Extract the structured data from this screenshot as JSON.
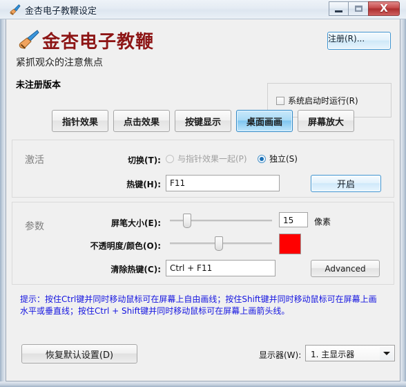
{
  "window": {
    "title": "金杏电子教鞭设定",
    "title_icon": "brush-pen-icon",
    "minimize_label": "",
    "maximize_label": "",
    "close_label": "X"
  },
  "header": {
    "logo_icon": "brush-pen-icon",
    "app_name": "金杏电子教鞭",
    "tagline": "紧抓观众的注意焦点",
    "license_status": "未注册版本",
    "register_button": "注册(R)...",
    "startup_checkbox_label": "系统启动时运行(R)",
    "startup_checked": false,
    "brand_color": "#8d1616"
  },
  "tabs": [
    {
      "label": "指针效果",
      "active": false
    },
    {
      "label": "点击效果",
      "active": false
    },
    {
      "label": "按键显示",
      "active": false
    },
    {
      "label": "桌面画画",
      "active": true
    },
    {
      "label": "屏幕放大",
      "active": false
    }
  ],
  "activate": {
    "section_title": "激活",
    "switch_label": "切换(T):",
    "radio_together": "与指针效果一起(P)",
    "radio_together_selected": false,
    "radio_together_disabled": true,
    "radio_standalone": "独立(S)",
    "radio_standalone_selected": true,
    "hotkey_label": "热键(H):",
    "hotkey_value": "F11",
    "start_button": "开启"
  },
  "params": {
    "section_title": "参数",
    "pen_size_label": "屏笔大小(E):",
    "pen_size_value": "15",
    "pen_size_unit": "像素",
    "pen_size_percent": 17,
    "opacity_label": "不透明度/颜色(O):",
    "opacity_percent": 48,
    "color_value": "#ff0000",
    "clear_hotkey_label": "清除热键(C):",
    "clear_hotkey_value": "Ctrl + F11",
    "advanced_button": "Advanced"
  },
  "hint": {
    "text": "提示：按住Ctrl键并同时移动鼠标可在屏幕上自由画线；按住Shift键并同时移动鼠标可在屏幕上画水平或垂直线；按住Ctrl + Shift键并同时移动鼠标可在屏幕上画箭头线。",
    "color": "#1414e0"
  },
  "footer": {
    "restore_button": "恢复默认设置(D)",
    "monitor_label": "显示器(W):",
    "monitor_value": "1. 主显示器"
  }
}
